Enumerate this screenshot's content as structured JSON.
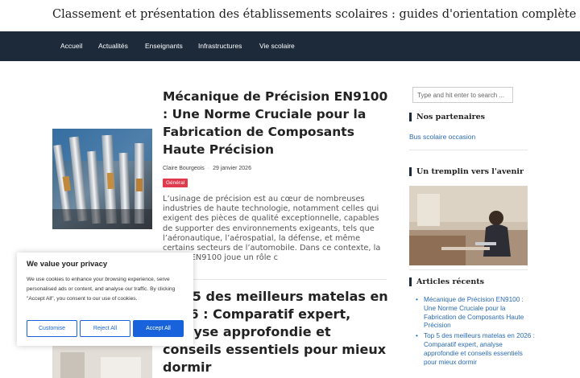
{
  "header": {
    "site_title": "Classement et présentation des établissements scolaires : guides d'orientation complète"
  },
  "nav": {
    "items": [
      {
        "label": "Accueil"
      },
      {
        "label": "Actualités"
      },
      {
        "label": "Enseignants"
      },
      {
        "label": "Infrastructures"
      },
      {
        "label": "Vie scolaire"
      }
    ]
  },
  "posts": [
    {
      "title": "Mécanique de Précision EN9100 : Une Norme Cruciale pour la Fabrication de Composants Haute Précision",
      "author": "Claire Bourgeois",
      "date": "29 janvier 2026",
      "category": "Général",
      "excerpt": "L’usinage de précision est au cœur de nombreuses industries de haute technologie, notamment celles qui exigent des pièces de qualité exceptionnelle, capables de supporter des environnements exigeants, tels que l’aéronautique, l’aérospatial, la défense, et même certains secteurs de l’automobile. Dans ce contexte, la norme EN9100 joue un rôle c"
    },
    {
      "title": "Top 5 des meilleurs matelas en 2026 : Comparatif expert, analyse approfondie et conseils essentiels pour mieux dormir"
    }
  ],
  "sidebar": {
    "search_placeholder": "Type and hit enter to search ...",
    "partners_title": "Nos partenaires",
    "partner_link": "Bus scolaire occasion",
    "future_title": "Un tremplin vers l'avenir",
    "recent_title": "Articles récents",
    "recent_items": [
      "Mécanique de Précision EN9100 : Une Norme Cruciale pour la Fabrication de Composants Haute Précision",
      "Top 5 des meilleurs matelas en 2026 : Comparatif expert, analyse approfondie et conseils essentiels pour mieux dormir"
    ]
  },
  "cookie": {
    "title": "We value your privacy",
    "text": "We use cookies to enhance your browsing experience, serve personalised ads or content, and analyse our traffic. By clicking \"Accept All\", you consent to our use of cookies.",
    "customise": "Customise",
    "reject": "Reject All",
    "accept": "Accept All"
  },
  "colors": {
    "nav_bg": "#1d2a3a",
    "badge": "#e03a4d",
    "link": "#2a6bb3",
    "cookie_accent": "#1863dc"
  }
}
